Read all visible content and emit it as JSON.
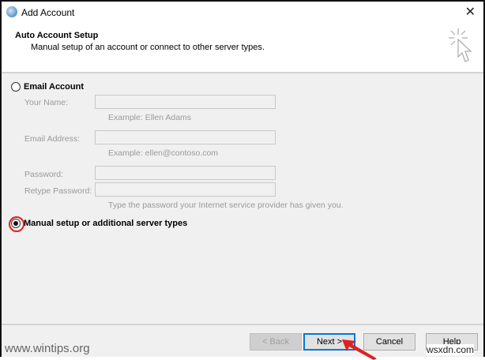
{
  "window": {
    "title": "Add Account",
    "close": "✕"
  },
  "header": {
    "title": "Auto Account Setup",
    "subtitle": "Manual setup of an account or connect to other server types."
  },
  "email_option": {
    "label": "Email Account",
    "selected": false,
    "your_name_label": "Your Name:",
    "your_name_value": "",
    "your_name_example": "Example: Ellen Adams",
    "email_label": "Email Address:",
    "email_value": "",
    "email_example": "Example: ellen@contoso.com",
    "password_label": "Password:",
    "retype_label": "Retype Password:",
    "password_hint": "Type the password your Internet service provider has given you."
  },
  "manual_option": {
    "label": "Manual setup or additional server types",
    "selected": true
  },
  "buttons": {
    "back": "< Back",
    "next": "Next >",
    "cancel": "Cancel",
    "help": "Help"
  },
  "watermarks": {
    "left": "www.wintips.org",
    "right": "wsxdn.com"
  },
  "colors": {
    "highlight": "#e02020",
    "default_button": "#0078d7"
  }
}
